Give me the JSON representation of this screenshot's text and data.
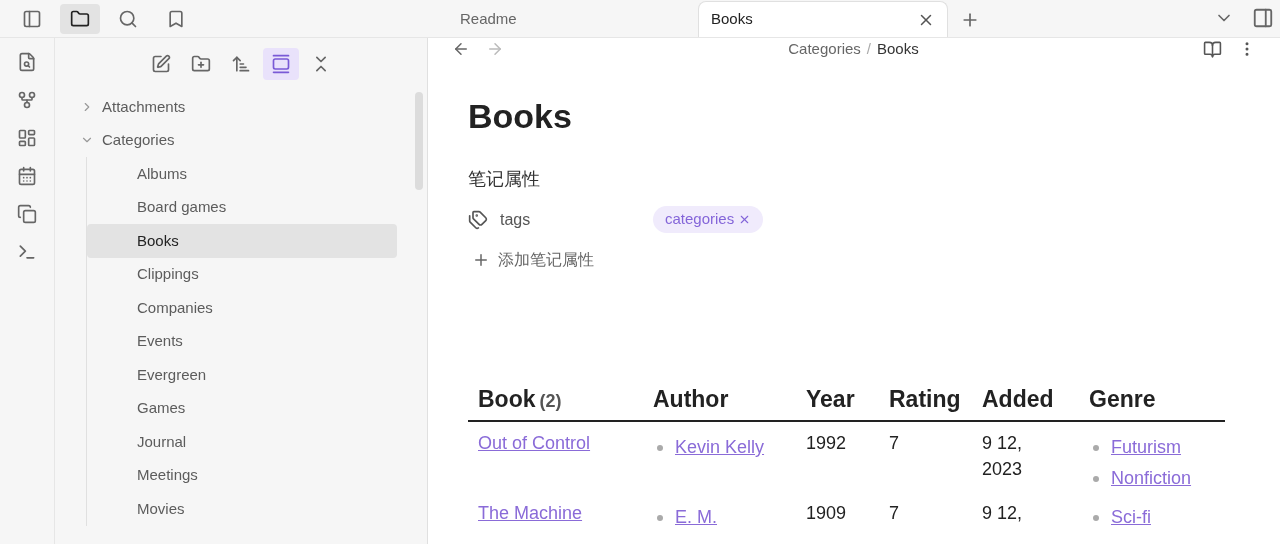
{
  "top_icons": [
    {
      "kind": "sidebar-toggle",
      "selected": false
    },
    {
      "kind": "files",
      "selected": true
    },
    {
      "kind": "search",
      "selected": false
    },
    {
      "kind": "bookmarks",
      "selected": false
    }
  ],
  "tabs": [
    {
      "label": "Readme",
      "selected": false
    },
    {
      "label": "Books",
      "selected": true
    }
  ],
  "explorer_toolbar": [
    {
      "kind": "new-note",
      "on": false
    },
    {
      "kind": "new-folder",
      "on": false
    },
    {
      "kind": "sort",
      "on": false
    },
    {
      "kind": "reveal",
      "on": true
    },
    {
      "kind": "collapse",
      "on": false
    }
  ],
  "tree": [
    {
      "label": "Attachments",
      "expanded": false,
      "selected": false
    },
    {
      "label": "Categories",
      "expanded": true,
      "selected": false,
      "children": [
        {
          "label": "Albums",
          "selected": false
        },
        {
          "label": "Board games",
          "selected": false
        },
        {
          "label": "Books",
          "selected": true
        },
        {
          "label": "Clippings",
          "selected": false
        },
        {
          "label": "Companies",
          "selected": false
        },
        {
          "label": "Events",
          "selected": false
        },
        {
          "label": "Evergreen",
          "selected": false
        },
        {
          "label": "Games",
          "selected": false
        },
        {
          "label": "Journal",
          "selected": false
        },
        {
          "label": "Meetings",
          "selected": false
        },
        {
          "label": "Movies",
          "selected": false
        }
      ]
    }
  ],
  "nav": {
    "back_disabled": false,
    "forward_disabled": true
  },
  "breadcrumb": [
    "Categories",
    "Books"
  ],
  "breadcrumb_separator": "/",
  "note": {
    "title": "Books",
    "properties_heading": "笔记属性",
    "properties": [
      {
        "name": "tags",
        "values": [
          "categories"
        ]
      }
    ],
    "add_property": "添加笔记属性"
  },
  "table": {
    "columns": [
      {
        "label": "Book",
        "count": "(2)"
      },
      {
        "label": "Author"
      },
      {
        "label": "Year"
      },
      {
        "label": "Rating"
      },
      {
        "label": "Added"
      },
      {
        "label": "Genre"
      }
    ],
    "rows": [
      {
        "book": "Out of Control",
        "authors": [
          "Kevin Kelly"
        ],
        "year": "1992",
        "rating": "7",
        "added": "9 12, 2023",
        "genres": [
          "Futurism",
          "Nonfiction"
        ]
      },
      {
        "book": "The Machine",
        "authors": [
          "E. M."
        ],
        "year": "1909",
        "rating": "7",
        "added": "9 12,",
        "genres": [
          "Sci-fi"
        ]
      }
    ]
  }
}
